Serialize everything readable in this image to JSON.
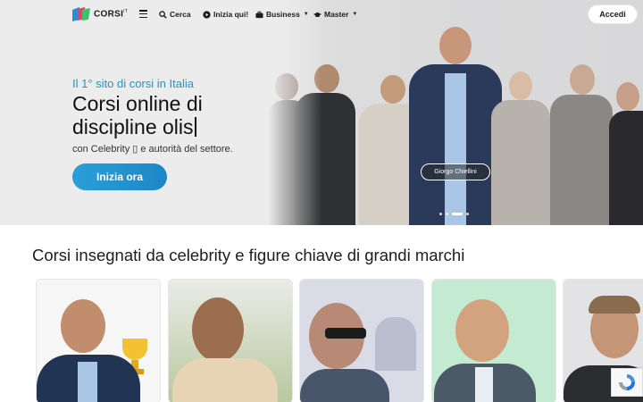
{
  "nav": {
    "logo_text": "CORSI",
    "logo_sup": "IT",
    "items": [
      {
        "label": "Cerca",
        "icon": "search-icon"
      },
      {
        "label": "Inizia qui!",
        "icon": "play-circle-icon"
      },
      {
        "label": "Business",
        "icon": "briefcase-icon",
        "has_caret": true
      },
      {
        "label": "Master",
        "icon": "graduation-cap-icon",
        "has_caret": true
      }
    ],
    "login_label": "Accedi"
  },
  "hero": {
    "tagline": "Il 1° sito di corsi in Italia",
    "headline": "Corsi online di discipline olis",
    "subline": "con Celebrity ▯ e autorità del settore.",
    "cta_label": "Inizia ora",
    "featured_name": "Giorgo Chiellini",
    "slides_count": 4,
    "active_slide": 2
  },
  "section": {
    "title": "Corsi insegnati da celebrity e figure chiave di grandi marchi"
  },
  "colors": {
    "accent": "#2b8fc8",
    "cta": "#1f86c6",
    "hero_bg": "#ececed"
  }
}
